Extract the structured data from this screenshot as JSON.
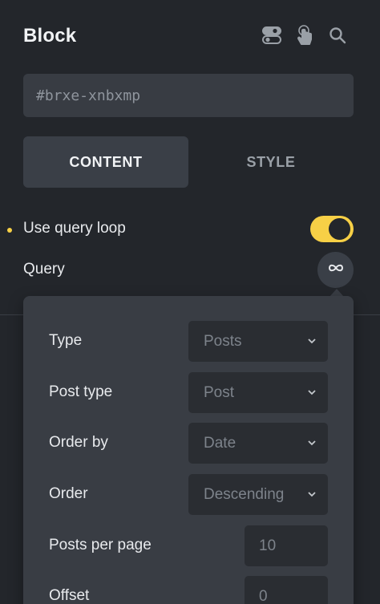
{
  "header": {
    "title": "Block"
  },
  "id_field": {
    "value": "#brxe-xnbxmp"
  },
  "tabs": [
    {
      "label": "CONTENT",
      "active": true
    },
    {
      "label": "STYLE",
      "active": false
    }
  ],
  "query_loop": {
    "label": "Use query loop",
    "enabled": true
  },
  "query": {
    "label": "Query"
  },
  "query_popup": {
    "type": {
      "label": "Type",
      "value": "Posts"
    },
    "post_type": {
      "label": "Post type",
      "value": "Post"
    },
    "order_by": {
      "label": "Order by",
      "value": "Date"
    },
    "order": {
      "label": "Order",
      "value": "Descending"
    },
    "posts_per_page": {
      "label": "Posts per page",
      "value": "10"
    },
    "offset": {
      "label": "Offset",
      "value": "0"
    }
  },
  "colors": {
    "background": "#23262b",
    "accent": "#f7d046",
    "surface": "#393d44"
  },
  "icons": [
    "toggle-settings-icon",
    "hand-pointer-icon",
    "search-icon",
    "infinity-icon",
    "chevron-down-icon"
  ]
}
